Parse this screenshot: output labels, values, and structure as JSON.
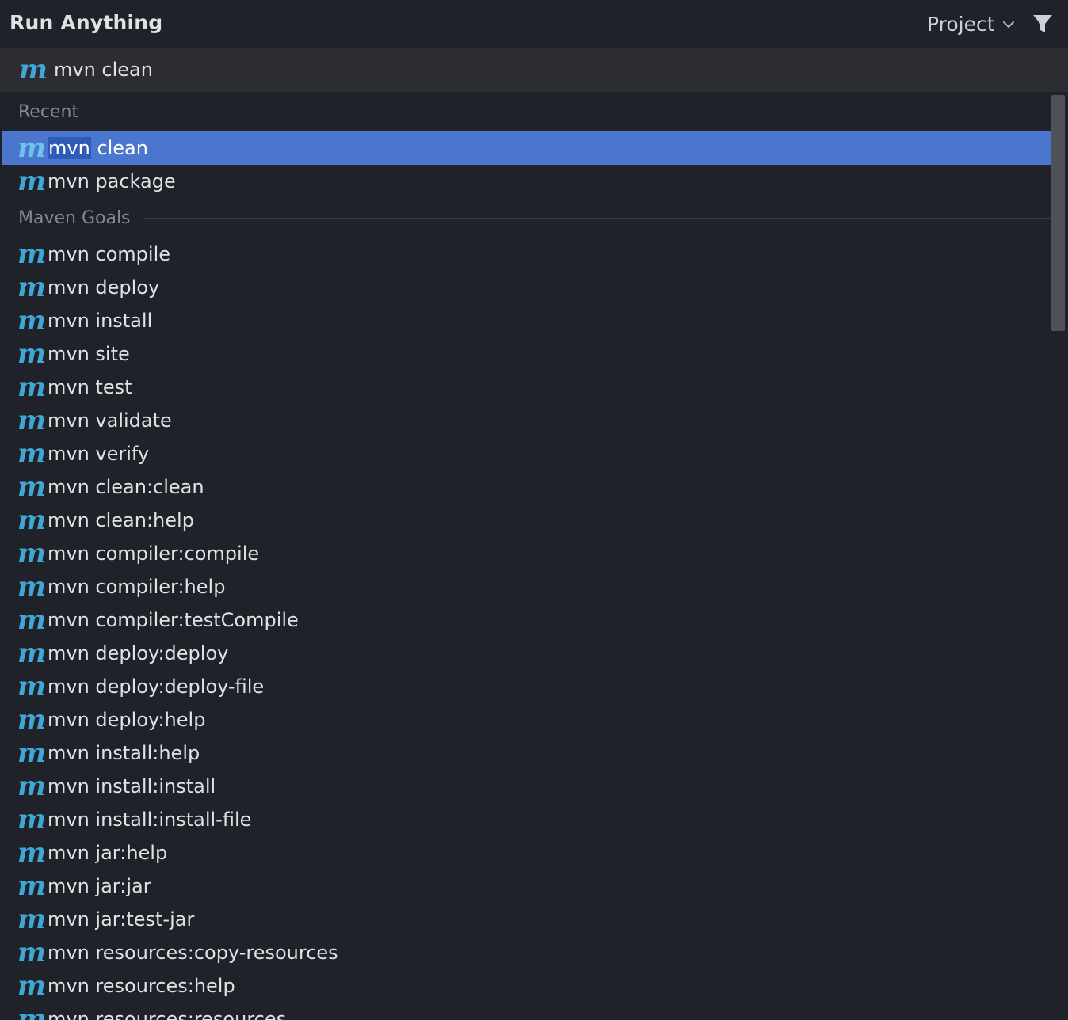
{
  "header": {
    "title": "Run Anything",
    "scope_label": "Project"
  },
  "search": {
    "icon": "maven-icon",
    "value": "mvn clean"
  },
  "groups": {
    "recent": {
      "label": "Recent",
      "items": [
        {
          "label_match": "mvn",
          "label_rest": " clean",
          "selected": true
        },
        {
          "label": "mvn package"
        }
      ]
    },
    "maven_goals": {
      "label": "Maven Goals",
      "items": [
        "mvn compile",
        "mvn deploy",
        "mvn install",
        "mvn site",
        "mvn test",
        "mvn validate",
        "mvn verify",
        "mvn clean:clean",
        "mvn clean:help",
        "mvn compiler:compile",
        "mvn compiler:help",
        "mvn compiler:testCompile",
        "mvn deploy:deploy",
        "mvn deploy:deploy-file",
        "mvn deploy:help",
        "mvn install:help",
        "mvn install:install",
        "mvn install:install-file",
        "mvn jar:help",
        "mvn jar:jar",
        "mvn jar:test-jar",
        "mvn resources:copy-resources",
        "mvn resources:help",
        "mvn resources:resources"
      ]
    }
  },
  "icon_glyph": "m",
  "colors": {
    "background": "#1f2228",
    "search_background": "#2b2d33",
    "selection": "#4a76cd",
    "maven_icon": "#3fa6d6",
    "group_label": "#858891"
  }
}
